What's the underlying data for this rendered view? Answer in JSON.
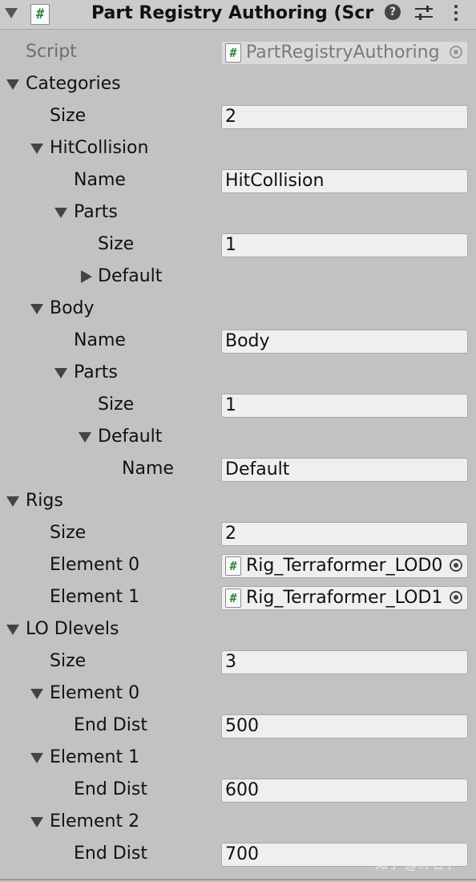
{
  "header": {
    "title": "Part Registry Authoring (Scrip",
    "help_glyph": "?",
    "icons": [
      "fold-triangle-icon",
      "script-hash-icon",
      "help-icon",
      "settings-sliders-icon",
      "more-menu-icon"
    ]
  },
  "script_row": {
    "label": "Script",
    "value": "PartRegistryAuthoring"
  },
  "categories": {
    "label": "Categories",
    "size_label": "Size",
    "size_value": "2",
    "hitcollision": {
      "label": "HitCollision",
      "name_label": "Name",
      "name_value": "HitCollision",
      "parts_label": "Parts",
      "parts_size_label": "Size",
      "parts_size_value": "1",
      "default_label": "Default"
    },
    "body": {
      "label": "Body",
      "name_label": "Name",
      "name_value": "Body",
      "parts_label": "Parts",
      "parts_size_label": "Size",
      "parts_size_value": "1",
      "default_label": "Default",
      "default_name_label": "Name",
      "default_name_value": "Default"
    }
  },
  "rigs": {
    "label": "Rigs",
    "size_label": "Size",
    "size_value": "2",
    "element0_label": "Element 0",
    "element0_value": "Rig_Terraformer_LOD0",
    "element1_label": "Element 1",
    "element1_value": "Rig_Terraformer_LOD1"
  },
  "lodlevels": {
    "label": "LO Dlevels",
    "size_label": "Size",
    "size_value": "3",
    "elements": [
      {
        "label": "Element 0",
        "dist_label": "End Dist",
        "dist_value": "500"
      },
      {
        "label": "Element 1",
        "dist_label": "End Dist",
        "dist_value": "600"
      },
      {
        "label": "Element 2",
        "dist_label": "End Dist",
        "dist_value": "700"
      }
    ]
  },
  "watermark": "知乎 @林七千",
  "script_icon_glyph": "#"
}
